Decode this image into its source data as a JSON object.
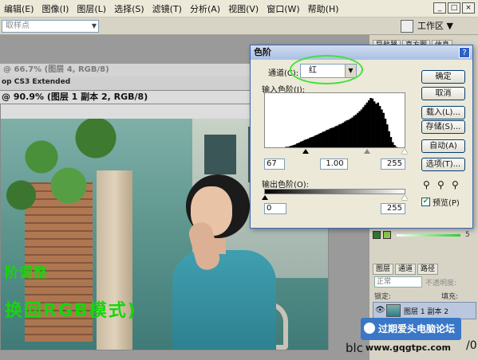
{
  "menubar": {
    "items": [
      "编辑(E)",
      "图像(I)",
      "图层(L)",
      "选择(S)",
      "滤镜(T)",
      "分析(A)",
      "视图(V)",
      "窗口(W)",
      "帮助(H)"
    ],
    "window_buttons": [
      "_",
      "□",
      "×"
    ]
  },
  "optionsbar": {
    "sample_select": "取样点",
    "workspace_label": "工作区 ▼"
  },
  "documents": {
    "doc1_title": "@ 66.7% (图层 4, RGB/8)",
    "doc1_subtitle": "op CS3 Extended",
    "doc2_title": "@ 90.9% (图层 1 副本 2, RGB/8)",
    "overlay_line1": "阶调整",
    "overlay_line2": "换回RGB模式)"
  },
  "panels": {
    "top_tabs": [
      "导航器",
      "直方图",
      "信息"
    ],
    "swatch_value": "5",
    "layers_tabs": [
      "图层",
      "通道",
      "路径"
    ],
    "blend_mode": "正常",
    "opacity_label": "不透明度:",
    "lock_label": "锁定:",
    "fill_label": "填充:",
    "layer_name": "图层 1 副本 2"
  },
  "watermark": {
    "text": "过期爱头电脑论坛",
    "url": "www.gqgtpc.com",
    "blog_fragment": "blc",
    "corner_fragment": "/0"
  },
  "levels_dialog": {
    "title": "色阶",
    "help_icon": "?",
    "channel_label": "通道(C):",
    "channel_value": "红",
    "input_levels_label": "输入色阶(I):",
    "input_values": [
      "67",
      "1.00",
      "255"
    ],
    "output_levels_label": "输出色阶(O):",
    "output_values": [
      "0",
      "255"
    ],
    "buttons": {
      "ok": "确定",
      "cancel": "取消",
      "load": "载入(L)...",
      "save": "存储(S)...",
      "auto": "自动(A)",
      "options": "选项(T)..."
    },
    "preview_label": "预览(P)",
    "preview_checked": true,
    "input_slider": {
      "black": 67,
      "gamma": 1.0,
      "white": 255
    },
    "histogram": [
      0,
      0,
      0,
      0,
      0,
      0,
      0,
      0,
      0,
      0,
      0,
      1,
      1,
      2,
      3,
      4,
      5,
      7,
      8,
      10,
      11,
      13,
      14,
      15,
      17,
      18,
      19,
      21,
      22,
      24,
      25,
      27,
      28,
      30,
      31,
      33,
      34,
      35,
      37,
      38,
      40,
      41,
      43,
      45,
      47,
      48,
      50,
      52,
      55,
      57,
      60,
      63,
      66,
      70,
      74,
      78,
      82,
      86,
      85,
      80,
      76,
      78,
      72,
      66,
      60,
      50,
      40,
      28,
      18,
      9,
      4,
      1,
      0,
      0,
      0,
      0
    ]
  },
  "colors": {
    "accent_green": "#19d40e",
    "dialog_border": "#3b65b5",
    "watermark_bg": "#3a78c7"
  }
}
